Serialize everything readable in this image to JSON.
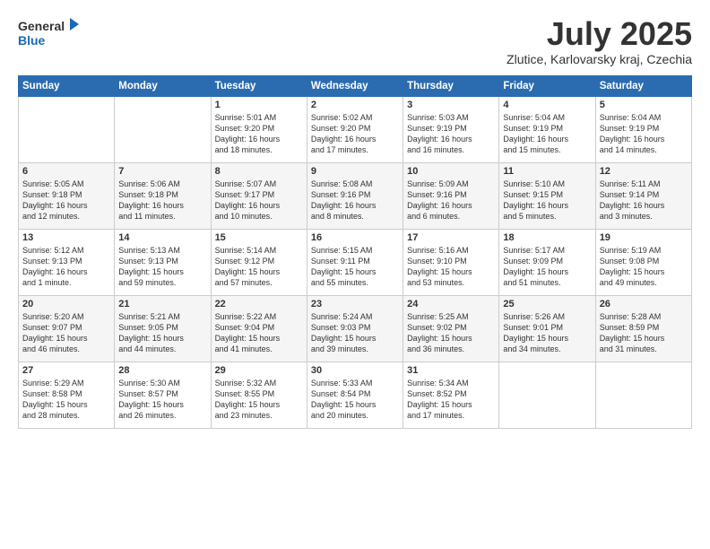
{
  "logo": {
    "line1": "General",
    "line2": "Blue"
  },
  "title": "July 2025",
  "subtitle": "Zlutice, Karlovarsky kraj, Czechia",
  "header_days": [
    "Sunday",
    "Monday",
    "Tuesday",
    "Wednesday",
    "Thursday",
    "Friday",
    "Saturday"
  ],
  "weeks": [
    [
      {
        "day": "",
        "info": ""
      },
      {
        "day": "",
        "info": ""
      },
      {
        "day": "1",
        "info": "Sunrise: 5:01 AM\nSunset: 9:20 PM\nDaylight: 16 hours\nand 18 minutes."
      },
      {
        "day": "2",
        "info": "Sunrise: 5:02 AM\nSunset: 9:20 PM\nDaylight: 16 hours\nand 17 minutes."
      },
      {
        "day": "3",
        "info": "Sunrise: 5:03 AM\nSunset: 9:19 PM\nDaylight: 16 hours\nand 16 minutes."
      },
      {
        "day": "4",
        "info": "Sunrise: 5:04 AM\nSunset: 9:19 PM\nDaylight: 16 hours\nand 15 minutes."
      },
      {
        "day": "5",
        "info": "Sunrise: 5:04 AM\nSunset: 9:19 PM\nDaylight: 16 hours\nand 14 minutes."
      }
    ],
    [
      {
        "day": "6",
        "info": "Sunrise: 5:05 AM\nSunset: 9:18 PM\nDaylight: 16 hours\nand 12 minutes."
      },
      {
        "day": "7",
        "info": "Sunrise: 5:06 AM\nSunset: 9:18 PM\nDaylight: 16 hours\nand 11 minutes."
      },
      {
        "day": "8",
        "info": "Sunrise: 5:07 AM\nSunset: 9:17 PM\nDaylight: 16 hours\nand 10 minutes."
      },
      {
        "day": "9",
        "info": "Sunrise: 5:08 AM\nSunset: 9:16 PM\nDaylight: 16 hours\nand 8 minutes."
      },
      {
        "day": "10",
        "info": "Sunrise: 5:09 AM\nSunset: 9:16 PM\nDaylight: 16 hours\nand 6 minutes."
      },
      {
        "day": "11",
        "info": "Sunrise: 5:10 AM\nSunset: 9:15 PM\nDaylight: 16 hours\nand 5 minutes."
      },
      {
        "day": "12",
        "info": "Sunrise: 5:11 AM\nSunset: 9:14 PM\nDaylight: 16 hours\nand 3 minutes."
      }
    ],
    [
      {
        "day": "13",
        "info": "Sunrise: 5:12 AM\nSunset: 9:13 PM\nDaylight: 16 hours\nand 1 minute."
      },
      {
        "day": "14",
        "info": "Sunrise: 5:13 AM\nSunset: 9:13 PM\nDaylight: 15 hours\nand 59 minutes."
      },
      {
        "day": "15",
        "info": "Sunrise: 5:14 AM\nSunset: 9:12 PM\nDaylight: 15 hours\nand 57 minutes."
      },
      {
        "day": "16",
        "info": "Sunrise: 5:15 AM\nSunset: 9:11 PM\nDaylight: 15 hours\nand 55 minutes."
      },
      {
        "day": "17",
        "info": "Sunrise: 5:16 AM\nSunset: 9:10 PM\nDaylight: 15 hours\nand 53 minutes."
      },
      {
        "day": "18",
        "info": "Sunrise: 5:17 AM\nSunset: 9:09 PM\nDaylight: 15 hours\nand 51 minutes."
      },
      {
        "day": "19",
        "info": "Sunrise: 5:19 AM\nSunset: 9:08 PM\nDaylight: 15 hours\nand 49 minutes."
      }
    ],
    [
      {
        "day": "20",
        "info": "Sunrise: 5:20 AM\nSunset: 9:07 PM\nDaylight: 15 hours\nand 46 minutes."
      },
      {
        "day": "21",
        "info": "Sunrise: 5:21 AM\nSunset: 9:05 PM\nDaylight: 15 hours\nand 44 minutes."
      },
      {
        "day": "22",
        "info": "Sunrise: 5:22 AM\nSunset: 9:04 PM\nDaylight: 15 hours\nand 41 minutes."
      },
      {
        "day": "23",
        "info": "Sunrise: 5:24 AM\nSunset: 9:03 PM\nDaylight: 15 hours\nand 39 minutes."
      },
      {
        "day": "24",
        "info": "Sunrise: 5:25 AM\nSunset: 9:02 PM\nDaylight: 15 hours\nand 36 minutes."
      },
      {
        "day": "25",
        "info": "Sunrise: 5:26 AM\nSunset: 9:01 PM\nDaylight: 15 hours\nand 34 minutes."
      },
      {
        "day": "26",
        "info": "Sunrise: 5:28 AM\nSunset: 8:59 PM\nDaylight: 15 hours\nand 31 minutes."
      }
    ],
    [
      {
        "day": "27",
        "info": "Sunrise: 5:29 AM\nSunset: 8:58 PM\nDaylight: 15 hours\nand 28 minutes."
      },
      {
        "day": "28",
        "info": "Sunrise: 5:30 AM\nSunset: 8:57 PM\nDaylight: 15 hours\nand 26 minutes."
      },
      {
        "day": "29",
        "info": "Sunrise: 5:32 AM\nSunset: 8:55 PM\nDaylight: 15 hours\nand 23 minutes."
      },
      {
        "day": "30",
        "info": "Sunrise: 5:33 AM\nSunset: 8:54 PM\nDaylight: 15 hours\nand 20 minutes."
      },
      {
        "day": "31",
        "info": "Sunrise: 5:34 AM\nSunset: 8:52 PM\nDaylight: 15 hours\nand 17 minutes."
      },
      {
        "day": "",
        "info": ""
      },
      {
        "day": "",
        "info": ""
      }
    ]
  ]
}
